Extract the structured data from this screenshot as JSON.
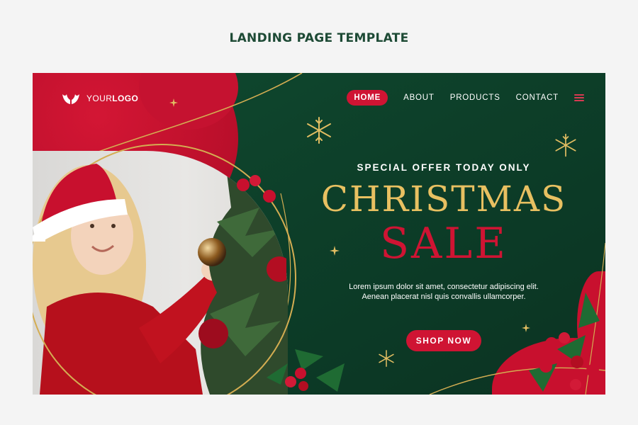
{
  "page": {
    "heading": "LANDING PAGE TEMPLATE"
  },
  "logo": {
    "text_regular": "YOUR",
    "text_bold": "LOGO"
  },
  "nav": {
    "items": [
      {
        "label": "HOME",
        "active": true
      },
      {
        "label": "ABOUT",
        "active": false
      },
      {
        "label": "PRODUCTS",
        "active": false
      },
      {
        "label": "CONTACT",
        "active": false
      }
    ]
  },
  "hero": {
    "offer": "SPECIAL OFFER TODAY ONLY",
    "title_line1": "CHRISTMAS",
    "title_line2": "SALE",
    "description_line1": "Lorem ipsum dolor sit amet, consectetur adipiscing elit.",
    "description_line2": "Aenean placerat nisl quis convallis ullamcorper.",
    "cta": "SHOP NOW"
  },
  "colors": {
    "green_dark": "#0d3f29",
    "red": "#cf1433",
    "gold": "#e8c061",
    "heading": "#1d4a35"
  },
  "icons": [
    "logo-antlers-icon",
    "menu-icon",
    "snowflake-icon",
    "sparkle-icon",
    "ornament-icon",
    "holly-icon",
    "santa-hat-icon"
  ]
}
